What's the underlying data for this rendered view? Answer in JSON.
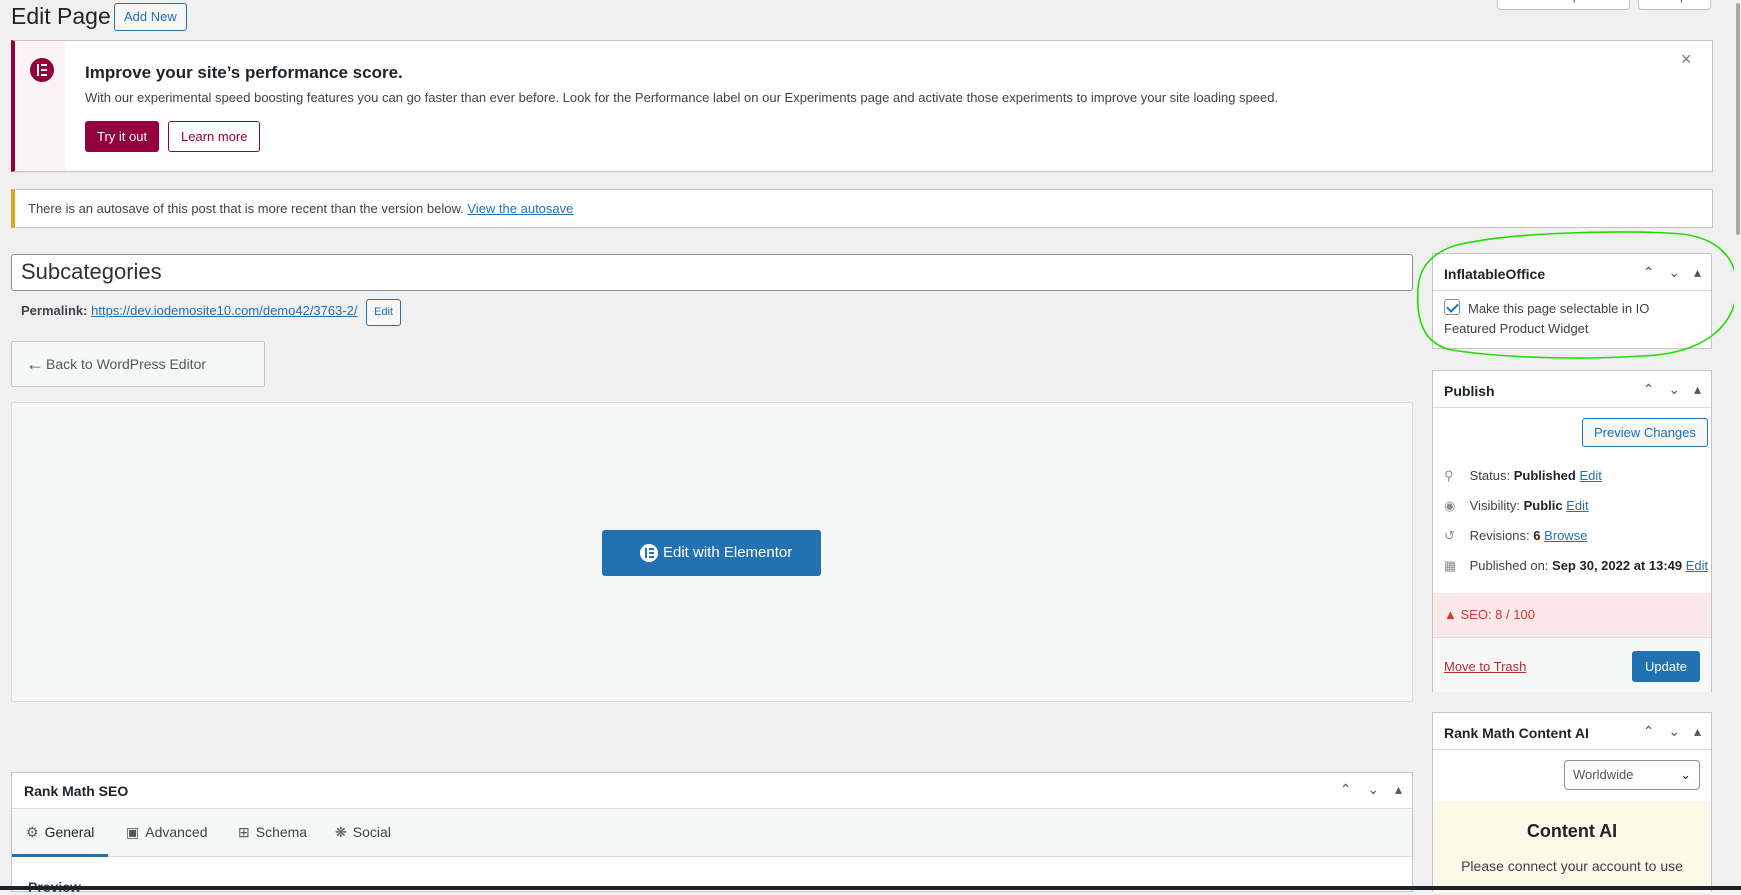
{
  "header": {
    "title": "Edit Page",
    "add_new": "Add New",
    "screen_options": "Screen Options",
    "help": "Help"
  },
  "perf_notice": {
    "title": "Improve your site’s performance score.",
    "text": "With our experimental speed boosting features you can go faster than ever before. Look for the Performance label on our Experiments page and activate those experiments to improve your site loading speed.",
    "try_label": "Try it out",
    "learn_label": "Learn more",
    "close_glyph": "×",
    "accent_color": "#93003c"
  },
  "autosave": {
    "text": "There is an autosave of this post that is more recent than the version below.",
    "link": "View the autosave"
  },
  "post": {
    "title": "Subcategories",
    "permalink_label": "Permalink:",
    "permalink_url": "https://dev.iodemosite10.com/demo42/3763-2/",
    "permalink_edit": "Edit",
    "back_button": "Back to WordPress Editor",
    "elementor_button": "Edit with Elementor"
  },
  "io_box": {
    "title": "InflatableOffice",
    "checkbox_label": "Make this page selectable in IO Featured Product Widget",
    "checked": true
  },
  "publish": {
    "title": "Publish",
    "preview_changes": "Preview Changes",
    "status_label": "Status:",
    "status_value": "Published",
    "status_edit": "Edit",
    "visibility_label": "Visibility:",
    "visibility_value": "Public",
    "visibility_edit": "Edit",
    "revisions_label": "Revisions:",
    "revisions_value": "6",
    "revisions_browse": "Browse",
    "published_label": "Published on:",
    "published_value": "Sep 30, 2022 at 13:49",
    "published_edit": "Edit",
    "seo_score": "SEO: 8 / 100",
    "move_to_trash": "Move to Trash",
    "update": "Update"
  },
  "content_ai": {
    "title": "Rank Math Content AI",
    "region": "Worldwide",
    "panel_title": "Content AI",
    "panel_text": "Please connect your account to use"
  },
  "rank_math": {
    "title": "Rank Math SEO",
    "tabs": [
      "General",
      "Advanced",
      "Schema",
      "Social"
    ],
    "preview_label": "Preview"
  },
  "colors": {
    "primary": "#2271b1",
    "elementor": "#93003c",
    "warning": "#dba617",
    "annotation": "#22dd00"
  }
}
